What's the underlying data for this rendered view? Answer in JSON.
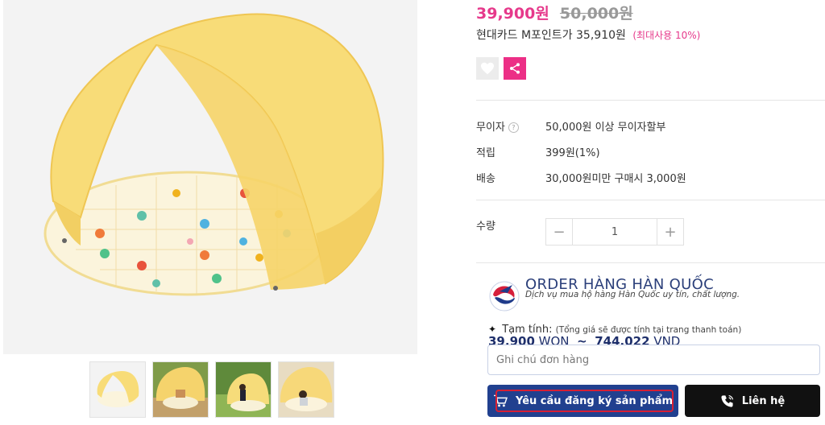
{
  "product": {
    "sale_price": "39,900원",
    "original_price": "50,000원",
    "card_promo": "현대카드 M포인트가 35,910원",
    "card_promo_max": "(최대사용 10%)"
  },
  "info": {
    "installment_label": "무이자",
    "installment_help": "?",
    "installment_value": "50,000원 이상 무이자할부",
    "points_label": "적립",
    "points_value": "399원(1%)",
    "shipping_label": "배송",
    "shipping_value": "30,000원미만 구매시 3,000원"
  },
  "quantity": {
    "label": "수량",
    "value": "1",
    "minus": "−",
    "plus": "+"
  },
  "order": {
    "title": "ORDER HÀNG HÀN QUỐC",
    "subtitle": "Dịch vụ mua hộ hàng Hàn Quốc uy tín, chất lượng.",
    "estimate_label": "Tạm tính:",
    "estimate_note": "(Tổng giá sẽ được tính tại trang thanh toán)",
    "won_amount": "39.900",
    "won_unit": "WON",
    "separator": "~",
    "vnd_amount": "744.022",
    "vnd_unit": "VND",
    "note_placeholder": "Ghi chú đơn hàng",
    "register_button": "Yêu cầu đăng ký sản phẩm",
    "contact_button": "Liên hệ"
  },
  "icons": {
    "like": "heart-icon",
    "share": "share-icon",
    "cart": "cart-icon",
    "phone": "phone-icon"
  },
  "colors": {
    "sale_price": "#e6398b",
    "share_bg": "#ec2f86",
    "primary_button": "#21408f",
    "contact_button": "#111111",
    "tent": "#f8dc78"
  }
}
